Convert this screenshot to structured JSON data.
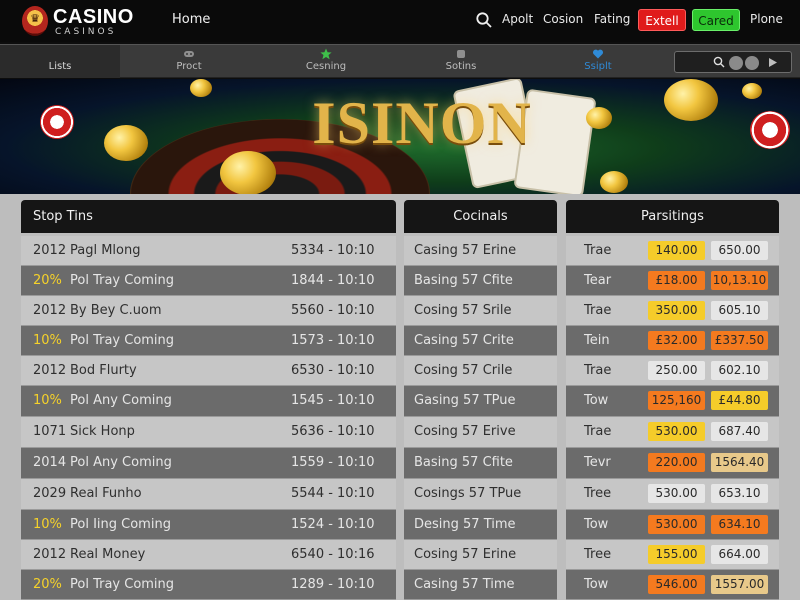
{
  "header": {
    "logo_main": "CASINO",
    "logo_sub": "CASINOS",
    "home": "Home",
    "nav": [
      "Apolt",
      "Cosion",
      "Fating"
    ],
    "btn_red": "Extell",
    "btn_green": "Cared",
    "phone": "Plone"
  },
  "tabs": [
    {
      "label": "Lists",
      "icon": "list-icon"
    },
    {
      "label": "Proct",
      "icon": "gamepad-icon"
    },
    {
      "label": "Cesning",
      "icon": "star-icon"
    },
    {
      "label": "Sotins",
      "icon": "chips-icon"
    },
    {
      "label": "Ssiplt",
      "icon": "heart-icon"
    }
  ],
  "hero": {
    "title": "ISINON"
  },
  "colors": {
    "accent_red": "#e01b1b",
    "accent_green": "#2ec62e",
    "pct_yellow": "#f6d22a",
    "pill_yellow": "#f5cc2a",
    "pill_orange": "#f47a1f",
    "pill_grey": "#e6e6e6"
  },
  "panels": {
    "left": {
      "title": "Stop Tins",
      "rows": [
        {
          "a": "2012",
          "b": "Pagl Mlong",
          "c": "5334 - 10:10"
        },
        {
          "a": "20%",
          "b": "Pol Tray Coming",
          "c": "1844 - 10:10"
        },
        {
          "a": "2012",
          "b": "By Bey C.uom",
          "c": "5560 - 10:10"
        },
        {
          "a": "10%",
          "b": "Pol Tray Coming",
          "c": "1573 - 10:10"
        },
        {
          "a": "2012",
          "b": "Bod Flurty",
          "c": "6530 - 10:10"
        },
        {
          "a": "10%",
          "b": "Pol Any Coming",
          "c": "1545 - 10:10"
        },
        {
          "a": "1071",
          "b": "Sick Honp",
          "c": "5636 - 10:10"
        },
        {
          "a": "2014",
          "b": "Pol Any Coming",
          "c": "1559 - 10:10"
        },
        {
          "a": "2029",
          "b": "Real Funho",
          "c": "5544 - 10:10"
        },
        {
          "a": "10%",
          "b": "Pol Iing Coming",
          "c": "1524 - 10:10"
        },
        {
          "a": "2012",
          "b": "Real Money",
          "c": "6540 - 10:16"
        },
        {
          "a": "20%",
          "b": "Pol Tray Coming",
          "c": "1289 - 10:10"
        }
      ]
    },
    "mid": {
      "title": "Cocinals",
      "rows": [
        "Casing 57 Erine",
        "Basing 57 Cfite",
        "Cosing 57 Srile",
        "Casing 57 Crite",
        "Cosing 57 Crile",
        "Gasing 57 TPue",
        "Cosing 57 Erive",
        "Basing 57 Cfite",
        "Cosings 57 TPue",
        "Desing 57 Time",
        "Cosing 57 Erine",
        "Casing 57 Time"
      ]
    },
    "right": {
      "title": "Parsitings",
      "rows": [
        {
          "label": "Trae",
          "v1": "140.00",
          "v2": "650.00"
        },
        {
          "label": "Tear",
          "v1": "£18.00",
          "v2": "10,13.10"
        },
        {
          "label": "Trae",
          "v1": "350.00",
          "v2": "605.10"
        },
        {
          "label": "Tein",
          "v1": "£32.00",
          "v2": "£337.50"
        },
        {
          "label": "Trae",
          "v1": "250.00",
          "v2": "602.10"
        },
        {
          "label": "Tow",
          "v1": "125,160",
          "v2": "£44.80"
        },
        {
          "label": "Trae",
          "v1": "530.00",
          "v2": "687.40"
        },
        {
          "label": "Tevr",
          "v1": "220.00",
          "v2": "1564.40"
        },
        {
          "label": "Tree",
          "v1": "530.00",
          "v2": "653.10"
        },
        {
          "label": "Tow",
          "v1": "530.00",
          "v2": "634.10"
        },
        {
          "label": "Tree",
          "v1": "155.00",
          "v2": "664.00"
        },
        {
          "label": "Tow",
          "v1": "546.00",
          "v2": "1557.00"
        }
      ]
    }
  }
}
